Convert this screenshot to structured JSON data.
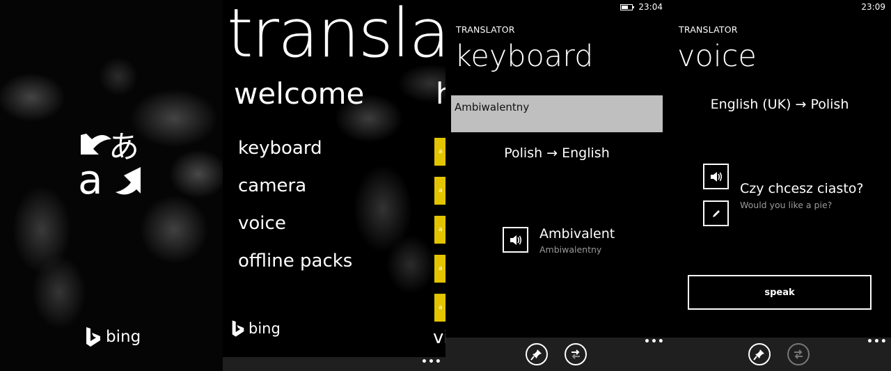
{
  "splash": {
    "logo_glyph_latin": "a",
    "logo_glyph_kana": "あ",
    "brand": "bing"
  },
  "hub": {
    "title": "translator",
    "section": "welcome",
    "next_section_peek": "h",
    "menu": [
      {
        "label": "keyboard"
      },
      {
        "label": "camera"
      },
      {
        "label": "voice"
      },
      {
        "label": "offline packs"
      }
    ],
    "tile_glyph": "a",
    "tiles_count": 5,
    "peek_text": "vi",
    "brand": "bing",
    "more_label": "•••",
    "tile_color": "#e3c400"
  },
  "keyboard": {
    "status": {
      "time": "23:04",
      "battery_level": 0.55
    },
    "app_label": "TRANSLATOR",
    "title": "keyboard",
    "input_value": "Ambiwalentny",
    "language_pair": "Polish → English",
    "result": {
      "translation": "Ambivalent",
      "source": "Ambiwalentny"
    },
    "appbar": {
      "more_label": "•••",
      "buttons": [
        "pin",
        "swap-languages"
      ]
    }
  },
  "voice": {
    "status": {
      "time": "23:09"
    },
    "app_label": "TRANSLATOR",
    "title": "voice",
    "language_pair": "English (UK) → Polish",
    "result": {
      "translation": "Czy chcesz ciasto?",
      "source": "Would you like a pie?"
    },
    "speak_label": "speak",
    "appbar": {
      "more_label": "•••",
      "buttons": [
        "pin",
        "swap-languages-disabled"
      ]
    }
  }
}
